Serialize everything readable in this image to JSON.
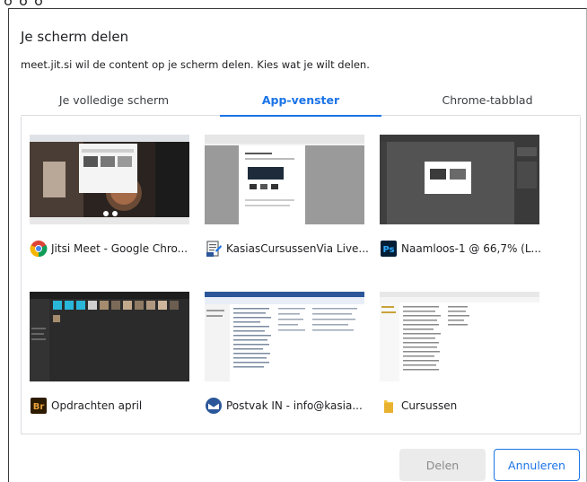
{
  "dialog": {
    "title": "Je scherm delen",
    "subtitle": "meet.jit.si wil de content op je scherm delen. Kies wat je wilt delen."
  },
  "tabs": [
    {
      "label": "Je volledige scherm",
      "active": false
    },
    {
      "label": "App-venster",
      "active": true
    },
    {
      "label": "Chrome-tabblad",
      "active": false
    }
  ],
  "windows": [
    {
      "label": "Jitsi Meet - Google Chro...",
      "icon": "chrome-icon"
    },
    {
      "label": "KasiasCursussenVia Live...",
      "icon": "document-app-icon"
    },
    {
      "label": "Naamloos-1 @ 66,7% (L...",
      "icon": "photoshop-icon",
      "icon_text": "Ps"
    },
    {
      "label": "Opdrachten april",
      "icon": "bridge-icon",
      "icon_text": "Br"
    },
    {
      "label": "Postvak IN - info@kasia...",
      "icon": "mail-app-icon"
    },
    {
      "label": "Cursussen",
      "icon": "folder-icon"
    }
  ],
  "buttons": {
    "share": "Delen",
    "cancel": "Annuleren"
  },
  "colors": {
    "accent": "#1a73e8",
    "photoshop": "#001e36",
    "bridge": "#2d1b00",
    "folder": "#f5c542"
  }
}
